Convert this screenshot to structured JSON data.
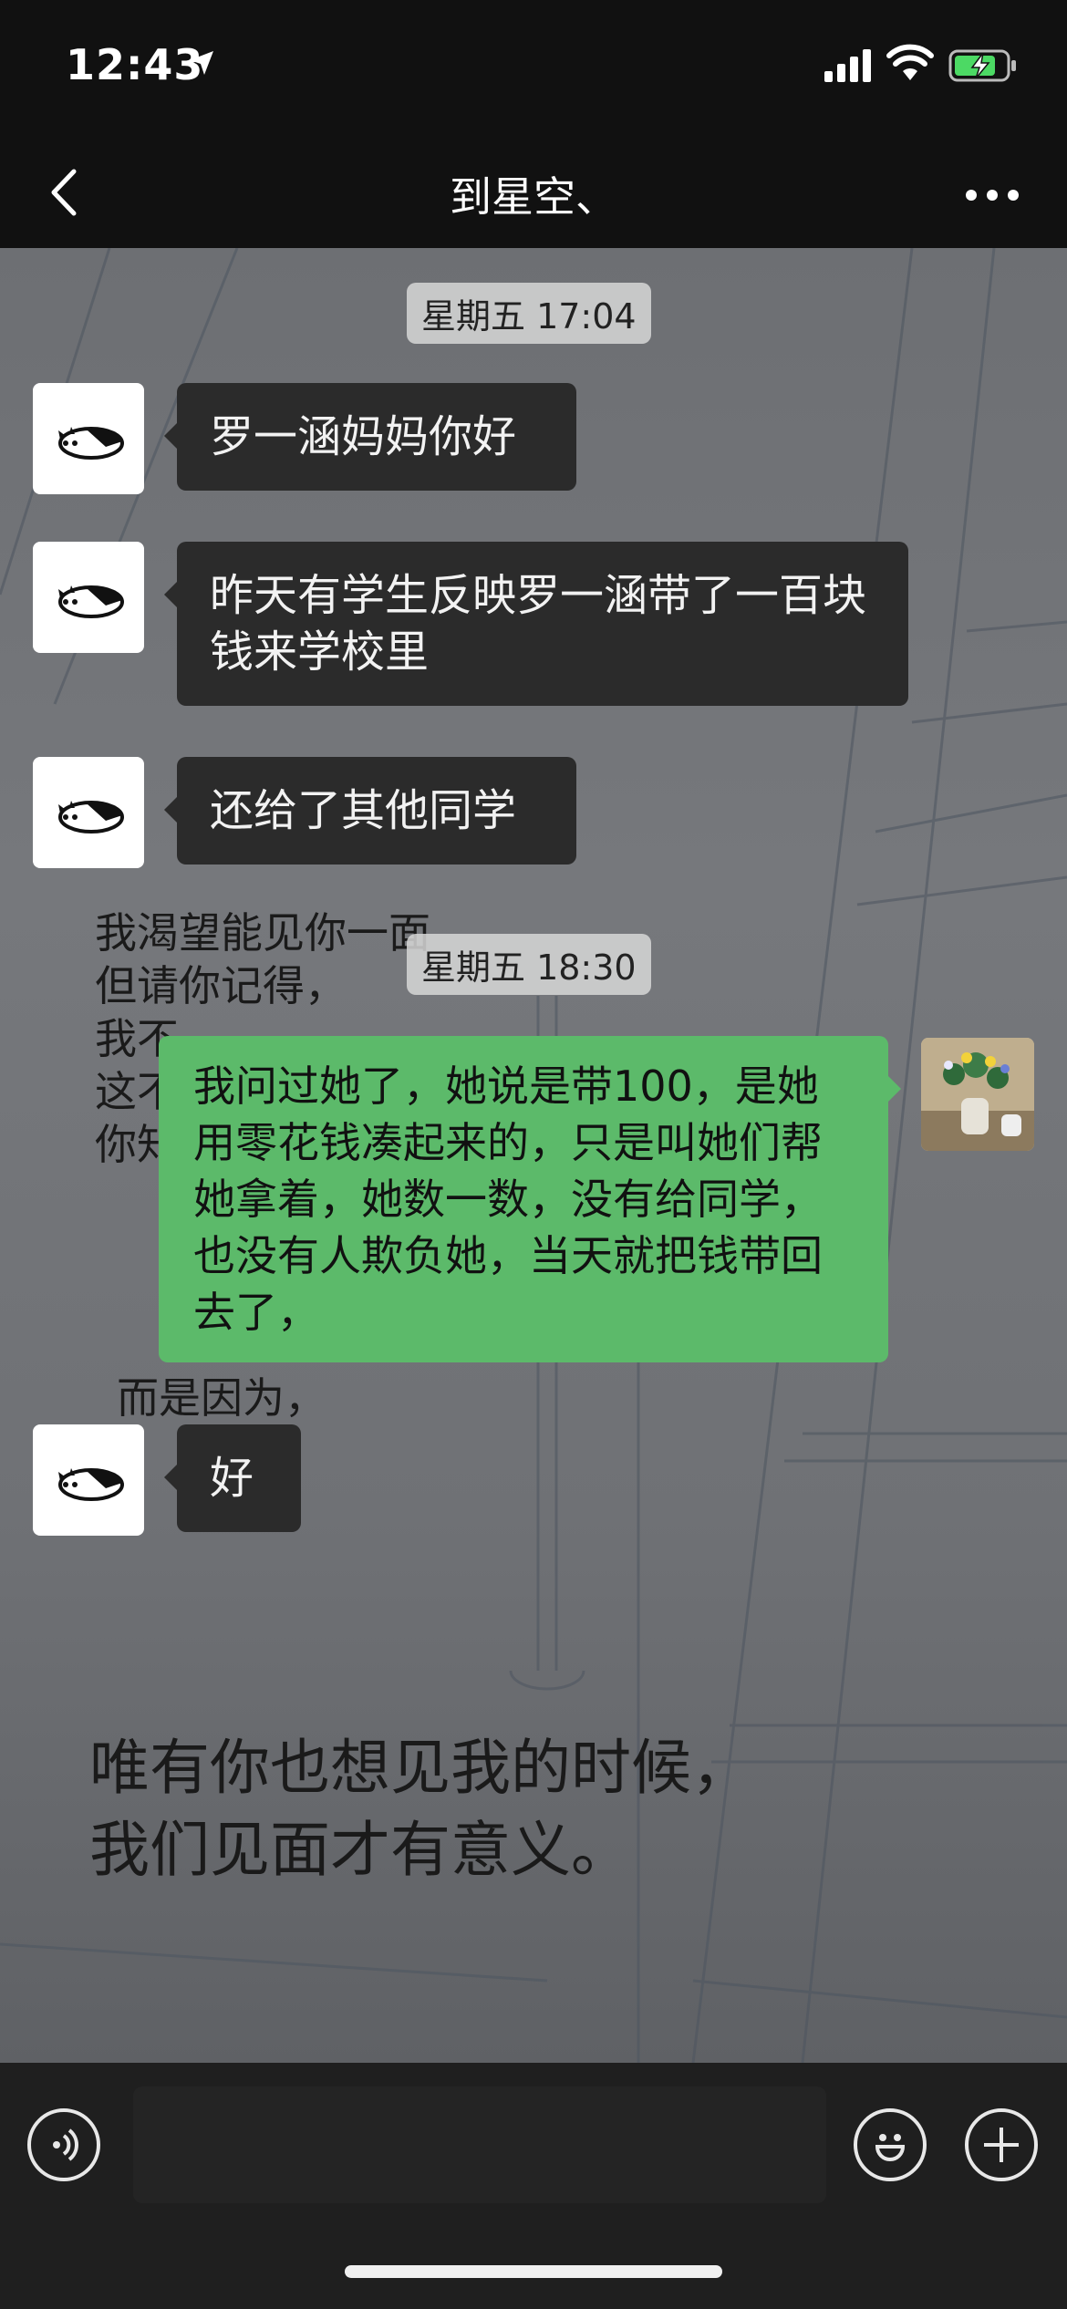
{
  "status_bar": {
    "time": "12:43"
  },
  "header": {
    "title": "到星空、"
  },
  "chat": {
    "timestamp_1": "星期五 17:04",
    "timestamp_2": "星期五 18:30",
    "messages": [
      {
        "side": "in",
        "text": "罗一涵妈妈你好"
      },
      {
        "side": "in",
        "text": "昨天有学生反映罗一涵带了一百块钱来学校里"
      },
      {
        "side": "in",
        "text": "还给了其他同学"
      },
      {
        "side": "out",
        "text": "我问过她了，她说是带100，是她用零花钱凑起来的，只是叫她们帮她拿着，她数一数，没有给同学，也没有人欺负她，当天就把钱带回去了，"
      },
      {
        "side": "in",
        "text": "好"
      }
    ]
  },
  "background_text": {
    "poem_small": "我渴望能见你一面\n但请你记得，\n我不\n这不\n你知",
    "poem_small_tail": "而是因为，",
    "poem_big_line1": "唯有你也想见我的时候，",
    "poem_big_line2": "我们见面才有意义。"
  },
  "icons": {
    "back": "chevron-left-icon",
    "more": "more-dots-icon",
    "voice": "voice-icon",
    "emoji": "emoji-icon",
    "plus": "plus-icon"
  },
  "colors": {
    "incoming_bubble": "#2b2b2b",
    "outgoing_bubble": "#5cba6a",
    "bar_background": "#111111"
  }
}
